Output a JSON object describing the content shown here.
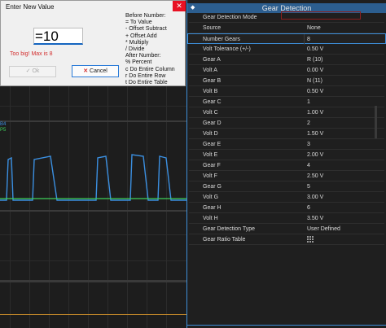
{
  "chart": {
    "trace_labels": [
      "B4",
      "P5"
    ],
    "colors": {
      "pulse": "#3b8fe0",
      "green": "#3ecf5a",
      "orange": "#c78a2a",
      "grid": "#2c2c2c"
    }
  },
  "dialog": {
    "title": "Enter New Value",
    "close_glyph": "✕",
    "input_value": "=10",
    "error": "Too big! Max is 8",
    "ok_label": "Ok",
    "cancel_label": "Cancel",
    "ok_icon": "check-icon",
    "cancel_icon": "x-icon",
    "help": [
      "Before Number:",
      "= To Value",
      "-  Offset Subtract",
      "+ Offset Add",
      "* Multiply",
      "/ Divide",
      "After Number:",
      "% Percent",
      "c  Do Entire Column",
      "r   Do Entire Row",
      "t   Do Entire Table"
    ]
  },
  "panel": {
    "title": "Gear Detection",
    "pin_icon": "pin-icon",
    "rows": [
      {
        "name": "Gear Detection Mode",
        "value": ""
      },
      {
        "name": "Source",
        "value": "None"
      },
      {
        "name": "Number Gears",
        "value": "8"
      },
      {
        "name": "Volt Tolerance (+/-)",
        "value": "0.50 V"
      },
      {
        "name": "Gear A",
        "value": "R (10)"
      },
      {
        "name": "Volt A",
        "value": "0.00 V"
      },
      {
        "name": "Gear B",
        "value": "N (11)"
      },
      {
        "name": "Volt B",
        "value": "0.50 V"
      },
      {
        "name": "Gear C",
        "value": "1"
      },
      {
        "name": "Volt C",
        "value": "1.00 V"
      },
      {
        "name": "Gear D",
        "value": "2"
      },
      {
        "name": "Volt D",
        "value": "1.50 V"
      },
      {
        "name": "Gear E",
        "value": "3"
      },
      {
        "name": "Volt E",
        "value": "2.00 V"
      },
      {
        "name": "Gear F",
        "value": "4"
      },
      {
        "name": "Volt F",
        "value": "2.50 V"
      },
      {
        "name": "Gear G",
        "value": "5"
      },
      {
        "name": "Volt G",
        "value": "3.00 V"
      },
      {
        "name": "Gear H",
        "value": "6"
      },
      {
        "name": "Volt H",
        "value": "3.50 V"
      },
      {
        "name": "Gear Detection Type",
        "value": "User Defined"
      },
      {
        "name": "Gear Ratio Table",
        "value": ""
      }
    ],
    "selected_row": "Number Gears",
    "table_icon": "grid-icon"
  }
}
